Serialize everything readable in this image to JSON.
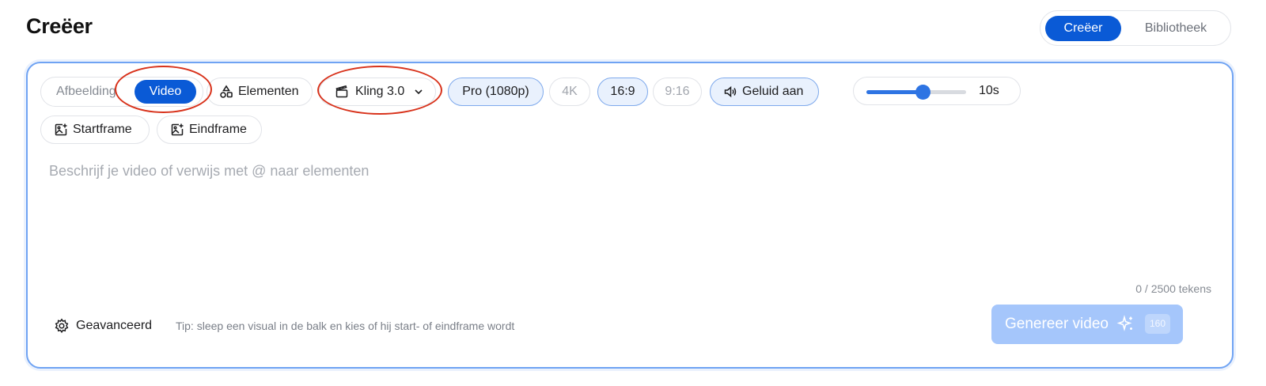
{
  "header": {
    "title": "Creëer",
    "view_tabs": [
      {
        "label": "Creëer",
        "active": true
      },
      {
        "label": "Bibliotheek",
        "active": false
      }
    ]
  },
  "composer": {
    "mode": {
      "options": [
        "Afbeelding",
        "Video"
      ],
      "selected": "Video"
    },
    "elements_label": "Elementen",
    "model": {
      "label": "Kling 3.0",
      "icon": "clapperboard-icon"
    },
    "resolution": {
      "options": [
        {
          "label": "Pro (1080p)",
          "active": true
        },
        {
          "label": "4K",
          "active": false
        }
      ]
    },
    "aspect_ratio": {
      "options": [
        {
          "label": "16:9",
          "active": true
        },
        {
          "label": "9:16",
          "active": false
        }
      ]
    },
    "sound": {
      "label": "Geluid aan",
      "active": true,
      "icon": "speaker-icon"
    },
    "duration": {
      "value_label": "10s",
      "fraction": 0.56
    },
    "frames": [
      {
        "label": "Startframe",
        "icon": "image-plus-icon"
      },
      {
        "label": "Eindframe",
        "icon": "image-plus-icon"
      }
    ],
    "prompt": {
      "value": "",
      "placeholder": "Beschrijf je video of verwijs met @ naar elementen"
    },
    "char_count": "0 / 2500 tekens",
    "advanced_label": "Geavanceerd",
    "tip": "Tip: sleep een visual in de balk en kies of hij start- of eindframe wordt",
    "generate": {
      "label": "Genereer video",
      "credits": "160"
    }
  },
  "colors": {
    "accent": "#0a5ad6",
    "generate_disabled": "#a5c6fb",
    "active_pill_bg": "#e9f1fd",
    "annotation": "#d8321b"
  }
}
